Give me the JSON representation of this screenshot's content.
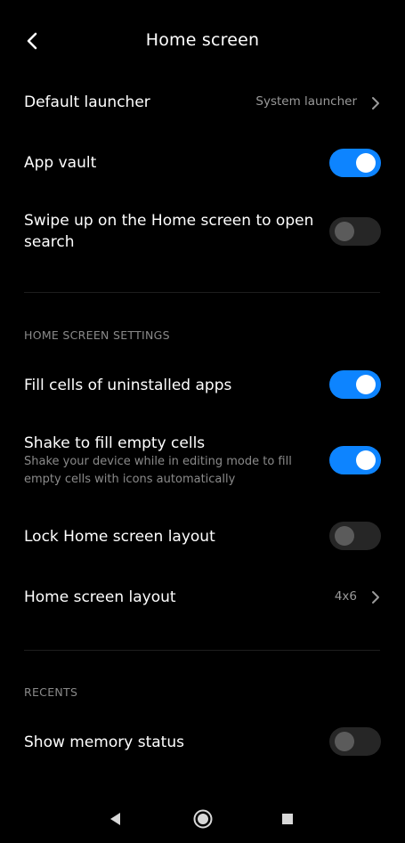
{
  "header": {
    "title": "Home screen"
  },
  "settings": {
    "default_launcher": {
      "label": "Default launcher",
      "value": "System launcher"
    },
    "app_vault": {
      "label": "App vault",
      "enabled": true
    },
    "swipe_up_search": {
      "label_line1": "Swipe up on the Home screen to open",
      "label_line2": "search",
      "enabled": false
    }
  },
  "home_screen_settings": {
    "section_title": "HOME SCREEN SETTINGS",
    "fill_cells": {
      "label": "Fill cells of uninstalled apps",
      "enabled": true
    },
    "shake_to_fill": {
      "label": "Shake to fill empty cells",
      "desc_line1": "Shake your device while in editing mode to fill",
      "desc_line2": "empty cells with icons automatically",
      "enabled": true
    },
    "lock_layout": {
      "label": "Lock Home screen layout",
      "enabled": false
    },
    "layout": {
      "label": "Home screen layout",
      "value": "4x6"
    }
  },
  "recents": {
    "section_title": "RECENTS",
    "show_memory": {
      "label": "Show memory status",
      "enabled": false
    }
  },
  "colors": {
    "accent": "#0d84ff",
    "background": "#000000",
    "toggle_off": "#262626"
  },
  "navbar": {
    "icons": [
      "back-triangle-icon",
      "home-circle-icon",
      "recents-square-icon"
    ]
  }
}
